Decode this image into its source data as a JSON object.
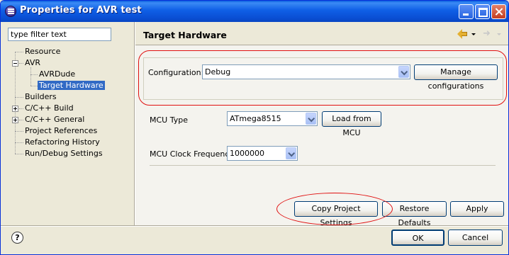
{
  "window": {
    "title": "Properties for AVR test"
  },
  "filter": {
    "value": "type filter text"
  },
  "tree": {
    "items": [
      {
        "label": "Resource"
      },
      {
        "label": "AVR"
      },
      {
        "label": "AVRDude"
      },
      {
        "label": "Target Hardware"
      },
      {
        "label": "Builders"
      },
      {
        "label": "C/C++ Build"
      },
      {
        "label": "C/C++ General"
      },
      {
        "label": "Project References"
      },
      {
        "label": "Refactoring History"
      },
      {
        "label": "Run/Debug Settings"
      }
    ],
    "selected": "Target Hardware"
  },
  "page": {
    "title": "Target Hardware",
    "nav_back_icon": "back-arrow-icon",
    "nav_forward_icon": "forward-arrow-icon"
  },
  "config": {
    "label": "Configuration:",
    "value": "Debug",
    "manage_label": "Manage configurations"
  },
  "mcu": {
    "type_label": "MCU Type",
    "type_value": "ATmega8515",
    "load_label": "Load from MCU",
    "clock_label": "MCU Clock Frequency",
    "clock_value": "1000000"
  },
  "actions": {
    "copy_label": "Copy Project Settings",
    "restore_label": "Restore Defaults",
    "apply_label": "Apply"
  },
  "dialog": {
    "help": "?",
    "ok_label": "OK",
    "cancel_label": "Cancel"
  },
  "colors": {
    "titlebar": "#0a4fd4",
    "selection": "#316ac5",
    "highlight_annotation": "#e01010"
  }
}
